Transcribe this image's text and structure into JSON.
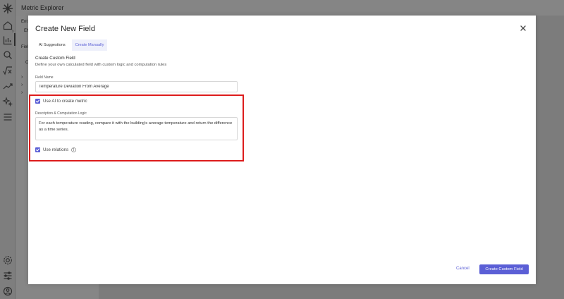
{
  "app": {
    "title": "Metric Explorer",
    "panel_fragments": [
      "Ent",
      "EN",
      "Field",
      "C"
    ],
    "rail_icons": [
      "logo-icon",
      "home-icon",
      "chart-icon",
      "search-icon",
      "function-icon",
      "trend-icon",
      "sparkle-icon",
      "list-icon",
      "settings-icon",
      "sliders-icon",
      "user-icon"
    ]
  },
  "modal": {
    "title": "Create New Field",
    "tabs": [
      {
        "label": "AI Suggestions",
        "active": false
      },
      {
        "label": "Create Manually",
        "active": true
      }
    ],
    "section_title": "Create Custom Field",
    "section_subtitle": "Define your own calculated field with custom logic and computation rules",
    "field_name_label": "Field Name",
    "field_name_value": "Temperature Deviation From Average",
    "use_ai_label": "Use AI to create metric",
    "use_ai_checked": true,
    "description_label": "Description & Computation Logic",
    "description_value": "For each temperature reading, compare it with the building's average temperature and return the difference as a time series.",
    "use_relations_label": "Use relations",
    "use_relations_checked": true,
    "cancel_label": "Cancel",
    "submit_label": "Create Custom Field"
  },
  "colors": {
    "accent": "#5b5fd6",
    "highlight": "#dd1c1c",
    "overlay": "#7d7d7d"
  }
}
